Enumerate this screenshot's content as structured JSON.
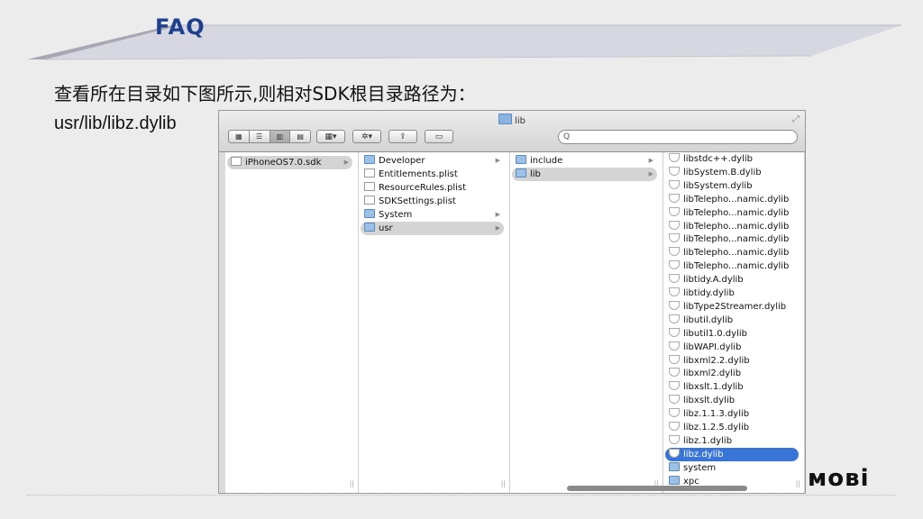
{
  "slide": {
    "title": "FAQ",
    "intro": "查看所在目录如下图所示,则相对SDK根目录路径为：",
    "path": "usr/lib/libz.dylib",
    "logo": "moBi"
  },
  "finder": {
    "window_title": "lib",
    "search_placeholder": "Q",
    "columns": [
      [
        {
          "label": "iPhoneOS7.0.sdk",
          "icon": "doc",
          "state": "gray",
          "arrow": true
        }
      ],
      [
        {
          "label": "Developer",
          "icon": "folder",
          "arrow": true
        },
        {
          "label": "Entitlements.plist",
          "icon": "doc"
        },
        {
          "label": "ResourceRules.plist",
          "icon": "doc"
        },
        {
          "label": "SDKSettings.plist",
          "icon": "doc"
        },
        {
          "label": "System",
          "icon": "folder",
          "arrow": true
        },
        {
          "label": "usr",
          "icon": "folder",
          "state": "gray",
          "arrow": true
        }
      ],
      [
        {
          "label": "include",
          "icon": "folder",
          "arrow": true
        },
        {
          "label": "lib",
          "icon": "folder",
          "state": "gray",
          "arrow": true
        }
      ],
      [
        {
          "label": "libstdc++.dylib",
          "icon": "alias"
        },
        {
          "label": "libSystem.B.dylib",
          "icon": "shield"
        },
        {
          "label": "libSystem.dylib",
          "icon": "alias"
        },
        {
          "label": "libTelepho...namic.dylib",
          "icon": "shield"
        },
        {
          "label": "libTelepho...namic.dylib",
          "icon": "shield"
        },
        {
          "label": "libTelepho...namic.dylib",
          "icon": "shield"
        },
        {
          "label": "libTelepho...namic.dylib",
          "icon": "shield"
        },
        {
          "label": "libTelepho...namic.dylib",
          "icon": "shield"
        },
        {
          "label": "libTelepho...namic.dylib",
          "icon": "shield"
        },
        {
          "label": "libtidy.A.dylib",
          "icon": "shield"
        },
        {
          "label": "libtidy.dylib",
          "icon": "alias"
        },
        {
          "label": "libType2Streamer.dylib",
          "icon": "shield"
        },
        {
          "label": "libutil.dylib",
          "icon": "alias"
        },
        {
          "label": "libutil1.0.dylib",
          "icon": "shield"
        },
        {
          "label": "libWAPI.dylib",
          "icon": "shield"
        },
        {
          "label": "libxml2.2.dylib",
          "icon": "shield"
        },
        {
          "label": "libxml2.dylib",
          "icon": "alias"
        },
        {
          "label": "libxslt.1.dylib",
          "icon": "shield"
        },
        {
          "label": "libxslt.dylib",
          "icon": "alias"
        },
        {
          "label": "libz.1.1.3.dylib",
          "icon": "alias"
        },
        {
          "label": "libz.1.2.5.dylib",
          "icon": "shield"
        },
        {
          "label": "libz.1.dylib",
          "icon": "alias"
        },
        {
          "label": "libz.dylib",
          "icon": "alias",
          "state": "blue"
        },
        {
          "label": "system",
          "icon": "folder"
        },
        {
          "label": "xpc",
          "icon": "folder"
        }
      ]
    ]
  }
}
